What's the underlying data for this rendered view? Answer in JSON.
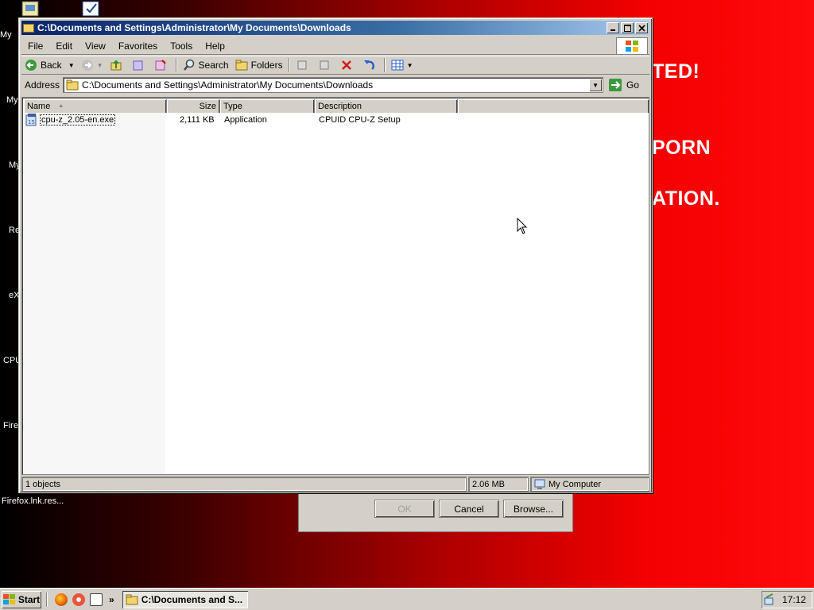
{
  "desktop": {
    "icon_labels": [
      "My",
      "My",
      "My",
      "Re",
      "eX",
      "CPU",
      "Firef"
    ],
    "ransom_lines": [
      "TED!",
      "PORN",
      "ATION."
    ],
    "firefox_label": "Firefox.lnk.res..."
  },
  "background_dialog": {
    "ok_label": "OK",
    "cancel_label": "Cancel",
    "browse_label": "Browse..."
  },
  "window": {
    "title": "C:\\Documents and Settings\\Administrator\\My Documents\\Downloads",
    "menu": [
      "File",
      "Edit",
      "View",
      "Favorites",
      "Tools",
      "Help"
    ],
    "toolbar": {
      "back_label": "Back",
      "search_label": "Search",
      "folders_label": "Folders"
    },
    "address": {
      "label": "Address",
      "value": "C:\\Documents and Settings\\Administrator\\My Documents\\Downloads",
      "go_label": "Go"
    },
    "columns": [
      "Name",
      "Size",
      "Type",
      "Description"
    ],
    "files": [
      {
        "name": "cpu-z_2.05-en.exe",
        "size": "2,111 KB",
        "type": "Application",
        "description": "CPUID CPU-Z Setup"
      }
    ],
    "status": {
      "objects": "1 objects",
      "size": "2.06 MB",
      "zone": "My Computer"
    }
  },
  "taskbar": {
    "start_label": "Start",
    "task_label": "C:\\Documents and S...",
    "overflow": "»",
    "clock": "17:12"
  },
  "colors": {
    "title_start": "#0a246a",
    "title_end": "#a6caf0",
    "face": "#d4d0c8",
    "desktop_red": "#ff0000"
  }
}
